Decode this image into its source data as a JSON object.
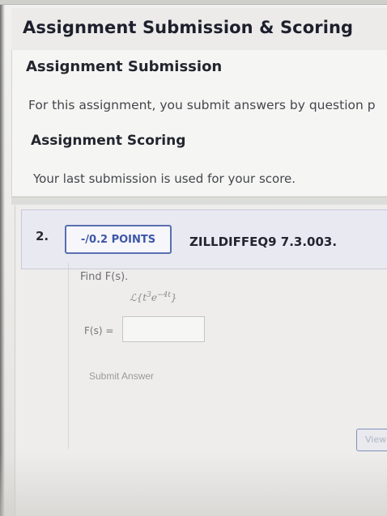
{
  "page_title": "Assignment Submission & Scoring",
  "submission": {
    "heading": "Assignment Submission",
    "text": "For this assignment, you submit answers by question p"
  },
  "scoring": {
    "heading": "Assignment Scoring",
    "text": "Your last submission is used for your score."
  },
  "question": {
    "number": "2.",
    "points_label": "-/0.2 POINTS",
    "code": "ZILLDIFFEQ9 7.3.003.",
    "prompt": "Find F(s).",
    "expression_prefix": "ℒ{t",
    "expression_exp1": "3",
    "expression_mid": "e",
    "expression_exp2": "−4t",
    "expression_suffix": "}",
    "answer_label": "F(s) =",
    "answer_value": "",
    "submit_label": "Submit Answer"
  },
  "view_button_label": "View"
}
